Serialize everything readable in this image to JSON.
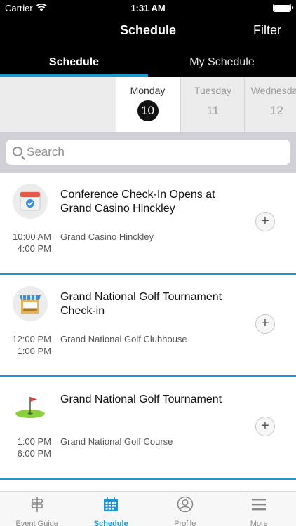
{
  "status_bar": {
    "carrier": "Carrier",
    "time": "1:31 AM"
  },
  "header": {
    "title": "Schedule",
    "filter_label": "Filter"
  },
  "tabs": [
    {
      "label": "Schedule",
      "active": true
    },
    {
      "label": "My Schedule",
      "active": false
    }
  ],
  "days": [
    {
      "name": "Monday",
      "number": "10",
      "selected": true
    },
    {
      "name": "Tuesday",
      "number": "11",
      "selected": false
    },
    {
      "name": "Wednesday",
      "number": "12",
      "selected": false
    }
  ],
  "search": {
    "placeholder": "Search"
  },
  "events": [
    {
      "title": "Conference Check-In Opens at Grand Casino Hinckley",
      "start": "10:00 AM",
      "end": "4:00 PM",
      "location": "Grand Casino Hinckley",
      "icon": "calendar-icon",
      "add_label": "+"
    },
    {
      "title": "Grand National Golf Tournament Check-in",
      "start": "12:00 PM",
      "end": "1:00 PM",
      "location": "Grand National Golf Clubhouse",
      "icon": "booth-icon",
      "add_label": "+"
    },
    {
      "title": "Grand National Golf Tournament",
      "start": "1:00 PM",
      "end": "6:00 PM",
      "location": "Grand National Golf Course",
      "icon": "golf-flag-icon",
      "add_label": "+"
    }
  ],
  "tabbar": [
    {
      "label": "Event Guide",
      "icon": "signpost-icon",
      "active": false
    },
    {
      "label": "Schedule",
      "icon": "calendar-icon",
      "active": true
    },
    {
      "label": "Profile",
      "icon": "profile-icon",
      "active": false
    },
    {
      "label": "More",
      "icon": "menu-icon",
      "active": false
    }
  ],
  "colors": {
    "accent": "#1a98d6",
    "header_bg": "#000000",
    "day_strip_bg": "#ececec",
    "search_bar_bg": "#d0d0d6"
  }
}
